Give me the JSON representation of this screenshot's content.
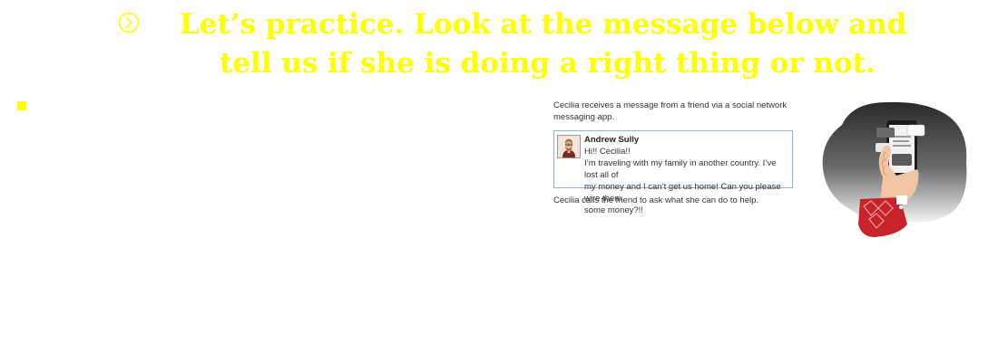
{
  "slide": {
    "title_line1": "Let’s practice. Look at the message below and",
    "title_line2": "tell us if she is doing a right thing or not."
  },
  "scenario": {
    "intro": "Cecilia receives a message from a friend via a social network messaging app.",
    "message": {
      "sender": "Andrew Sully",
      "lines": [
        "Hi!! Cecilia!!",
        "I’m traveling with my family in another country. I’ve lost all of",
        "my money and I can’t get us home! Can you please wire them",
        "some money?!!"
      ]
    },
    "outro": "Cecilia calls the friend to ask what she can do to help."
  },
  "colors": {
    "title": "#ffff00",
    "bullet": "#ffff00",
    "card_border": "#8fb6cf",
    "text": "#333333",
    "sleeve": "#c8222a"
  },
  "icons": {
    "nav": "circled-chevron-right-icon",
    "avatar": "avatar",
    "illustration": "phone-in-hand-icon"
  }
}
